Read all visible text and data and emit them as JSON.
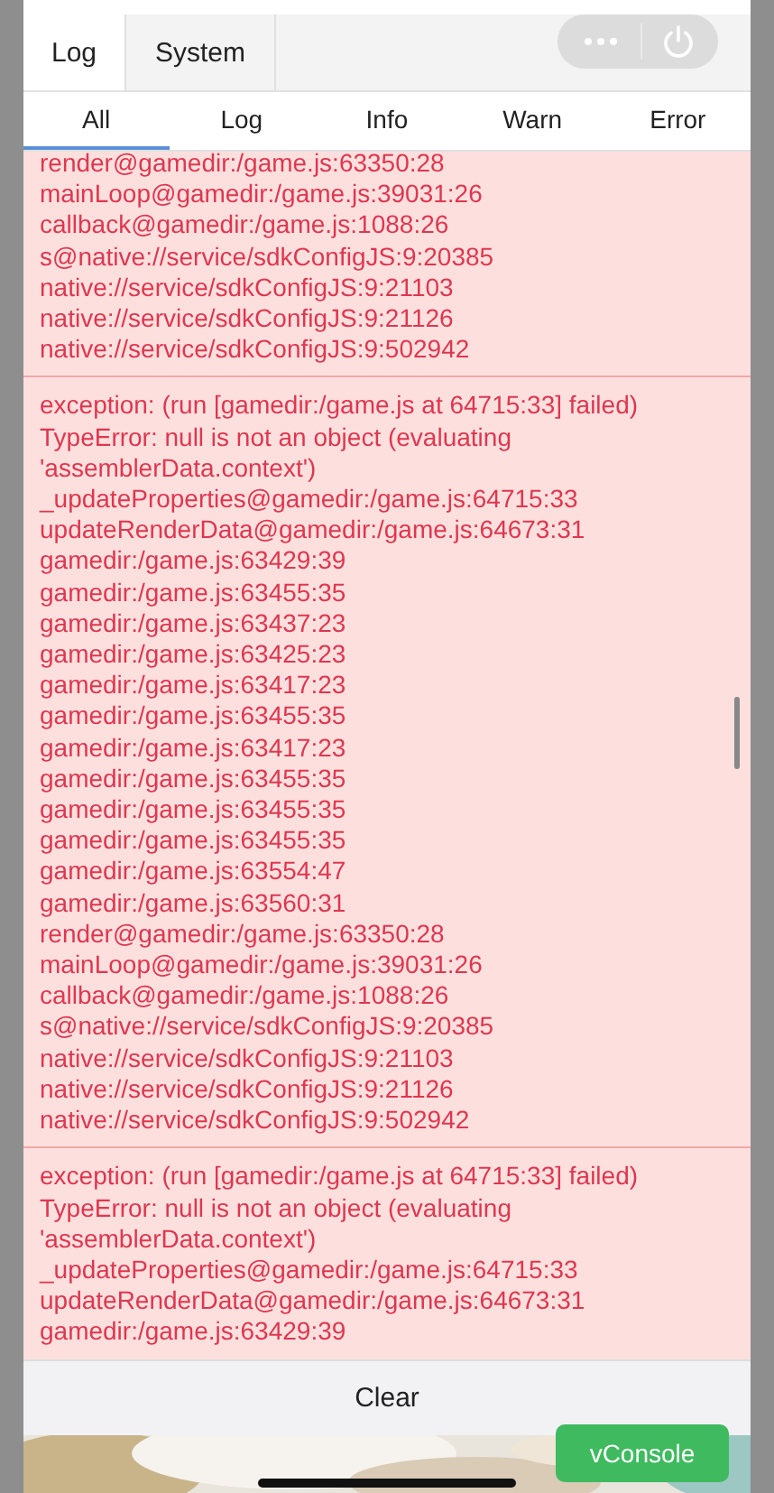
{
  "tabs": [
    {
      "label": "Log",
      "selected": true
    },
    {
      "label": "System",
      "selected": false
    }
  ],
  "filters": [
    {
      "label": "All",
      "selected": true
    },
    {
      "label": "Log",
      "selected": false
    },
    {
      "label": "Info",
      "selected": false
    },
    {
      "label": "Warn",
      "selected": false
    },
    {
      "label": "Error",
      "selected": false
    }
  ],
  "entries": [
    {
      "lines": [
        "render@gamedir:/game.js:63350:28",
        "mainLoop@gamedir:/game.js:39031:26",
        "callback@gamedir:/game.js:1088:26",
        "s@native://service/sdkConfigJS:9:20385",
        "native://service/sdkConfigJS:9:21103",
        "native://service/sdkConfigJS:9:21126",
        "native://service/sdkConfigJS:9:502942"
      ]
    },
    {
      "lines": [
        "exception: (run [gamedir:/game.js at 64715:33] failed)",
        "TypeError: null is not an object (evaluating 'assemblerData.context')",
        "_updateProperties@gamedir:/game.js:64715:33",
        "updateRenderData@gamedir:/game.js:64673:31",
        "gamedir:/game.js:63429:39",
        "gamedir:/game.js:63455:35",
        "gamedir:/game.js:63437:23",
        "gamedir:/game.js:63425:23",
        "gamedir:/game.js:63417:23",
        "gamedir:/game.js:63455:35",
        "gamedir:/game.js:63417:23",
        "gamedir:/game.js:63455:35",
        "gamedir:/game.js:63455:35",
        "gamedir:/game.js:63455:35",
        "gamedir:/game.js:63554:47",
        "gamedir:/game.js:63560:31",
        "render@gamedir:/game.js:63350:28",
        "mainLoop@gamedir:/game.js:39031:26",
        "callback@gamedir:/game.js:1088:26",
        "s@native://service/sdkConfigJS:9:20385",
        "native://service/sdkConfigJS:9:21103",
        "native://service/sdkConfigJS:9:21126",
        "native://service/sdkConfigJS:9:502942"
      ]
    },
    {
      "lines": [
        "exception: (run [gamedir:/game.js at 64715:33] failed)",
        "TypeError: null is not an object (evaluating 'assemblerData.context')",
        "_updateProperties@gamedir:/game.js:64715:33",
        "updateRenderData@gamedir:/game.js:64673:31",
        "gamedir:/game.js:63429:39"
      ]
    }
  ],
  "footer": {
    "clear": "Clear"
  },
  "launcher": {
    "label": "vConsole"
  }
}
